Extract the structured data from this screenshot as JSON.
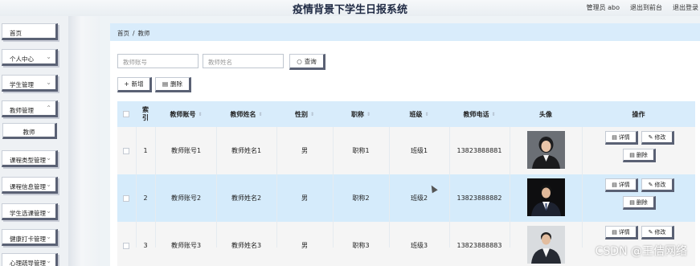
{
  "header": {
    "title": "疫情背景下学生日报系统",
    "actions": [
      "管理员 abo",
      "退出到前台",
      "退出登录"
    ]
  },
  "sidebar": {
    "items": [
      {
        "label": "首页",
        "has_chevron": false
      },
      {
        "label": "个人中心",
        "has_chevron": true
      },
      {
        "label": "学生管理",
        "has_chevron": true
      },
      {
        "label": "教师管理",
        "has_chevron": true
      },
      {
        "label": "教师",
        "sub": true
      },
      {
        "label": "课程类型管理",
        "has_chevron": true
      },
      {
        "label": "课程信息管理",
        "has_chevron": true
      },
      {
        "label": "学生选课管理",
        "has_chevron": true
      },
      {
        "label": "健康打卡管理",
        "has_chevron": true
      },
      {
        "label": "心理疏导管理",
        "has_chevron": true
      }
    ]
  },
  "breadcrumb": {
    "root": "首页",
    "sep": "/",
    "current": "教师"
  },
  "search": {
    "account_placeholder": "教师账号",
    "name_placeholder": "教师姓名",
    "query_label": "查询"
  },
  "toolbar": {
    "add_label": "新增",
    "delete_label": "删除"
  },
  "table": {
    "headers": [
      "索引",
      "教师账号",
      "教师姓名",
      "性别",
      "职称",
      "班级",
      "教师电话",
      "头像",
      "操作"
    ],
    "rows": [
      {
        "index": "1",
        "account": "教师账号1",
        "name": "教师姓名1",
        "gender": "男",
        "title": "职称1",
        "class": "班级1",
        "phone": "13823888881"
      },
      {
        "index": "2",
        "account": "教师账号2",
        "name": "教师姓名2",
        "gender": "男",
        "title": "职称2",
        "class": "班级2",
        "phone": "13823888882"
      },
      {
        "index": "3",
        "account": "教师账号3",
        "name": "教师姓名3",
        "gender": "男",
        "title": "职称3",
        "class": "班级3",
        "phone": "13823888883"
      }
    ],
    "row_actions": {
      "detail": "详情",
      "edit": "修改",
      "delete": "删除"
    }
  },
  "watermark": "CSDN @王佶网络",
  "colors": {
    "accent_blue": "#d8ecfb",
    "button_border": "#5a6174",
    "row_alt": "#d5ebfb"
  }
}
